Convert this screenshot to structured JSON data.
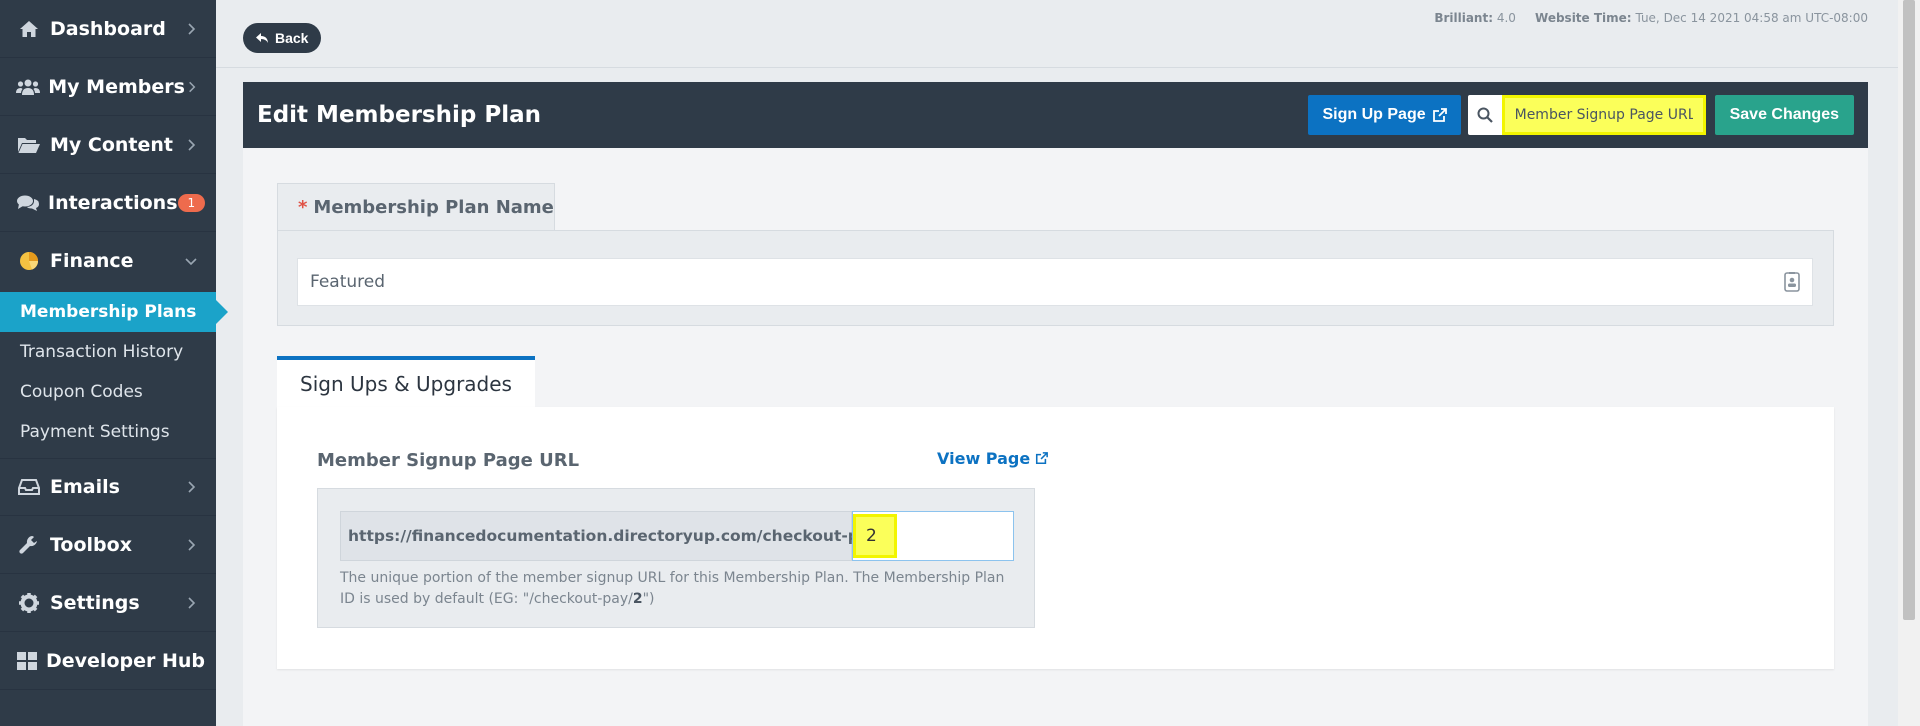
{
  "sidebar": {
    "items": [
      {
        "label": "Dashboard"
      },
      {
        "label": "My Members"
      },
      {
        "label": "My Content"
      },
      {
        "label": "Interactions",
        "badge": "1"
      },
      {
        "label": "Finance"
      }
    ],
    "finance_sub": [
      {
        "label": "Membership Plans"
      },
      {
        "label": "Transaction History"
      },
      {
        "label": "Coupon Codes"
      },
      {
        "label": "Payment Settings"
      }
    ],
    "items_after": [
      {
        "label": "Emails"
      },
      {
        "label": "Toolbox"
      },
      {
        "label": "Settings"
      },
      {
        "label": "Developer Hub"
      }
    ]
  },
  "topbar": {
    "back_label": "Back",
    "version_label": "Brilliant:",
    "version_value": "4.0",
    "time_label": "Website Time:",
    "time_value": "Tue, Dec 14 2021 04:58 am UTC-08:00"
  },
  "editor": {
    "title": "Edit Membership Plan",
    "signup_btn": "Sign Up Page",
    "search_value": "Member Signup Page URL",
    "save_btn": "Save Changes"
  },
  "plan_name": {
    "required_mark": "*",
    "tab_label": "Membership Plan Name",
    "value": "Featured"
  },
  "signups": {
    "tab_label": "Sign Ups & Upgrades",
    "field_label": "Member Signup Page URL",
    "view_link": "View Page",
    "url_prefix": "https://financedocumentation.directoryup.com/checkout-pay/",
    "url_value": "2",
    "help_text_1": "The unique portion of the member signup URL for this Membership Plan. The Membership Plan ID is used by default (EG: \"/checkout-pay/",
    "help_bold": "2",
    "help_text_2": "\")"
  },
  "colors": {
    "sidebar_bg": "#2f3b48",
    "active_item": "#1ba3c9",
    "primary": "#0c72c2",
    "save": "#29a38c",
    "badge": "#ee6b4d",
    "highlight": "#fbff5a"
  }
}
